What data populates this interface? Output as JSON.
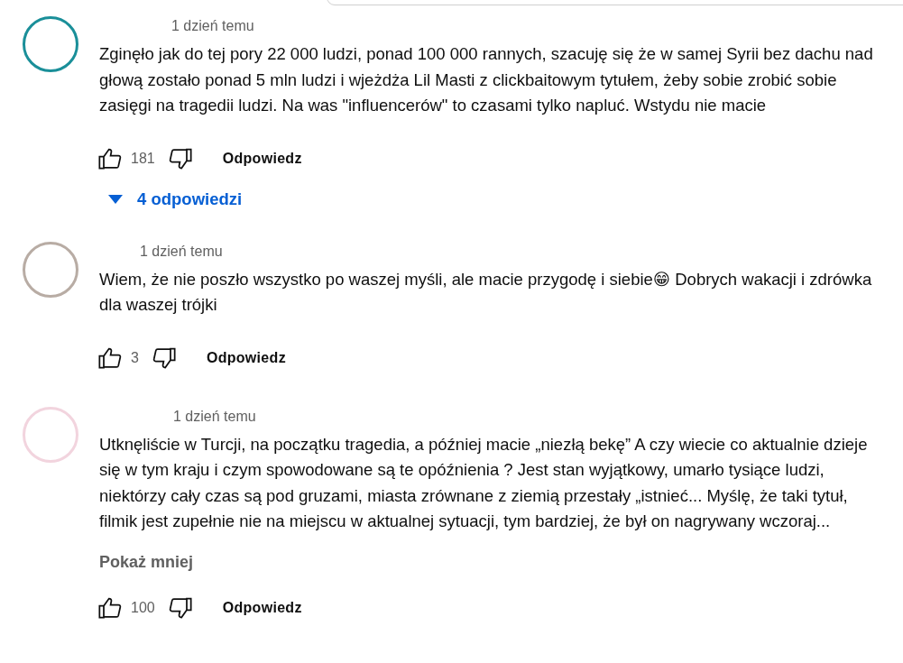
{
  "comments": [
    {
      "avatar": {
        "color": "#1a8f99"
      },
      "time": "1 dzień temu",
      "text": "Zginęło jak do tej pory 22 000 ludzi, ponad 100 000 rannych, szacuję się że w samej Syrii bez dachu nad głową zostało ponad 5 mln ludzi i wjeżdża Lil Masti z clickbaitowym tytułem, żeby sobie zrobić sobie zasięgi na tragedii ludzi. Na was \"influencerów\" to czasami tylko napluć. Wstydu nie macie",
      "likes": "181",
      "reply": "Odpowiedz",
      "replies": {
        "label": "4 odpowiedzi",
        "expanded": false
      }
    },
    {
      "avatar": {
        "color": "#b8aca4"
      },
      "time": "1 dzień temu",
      "text": "Wiem, że nie poszło wszystko po waszej myśli, ale macie przygodę i siebie😁 Dobrych wakacji i zdrówka dla waszej trójki",
      "likes": "3",
      "reply": "Odpowiedz"
    },
    {
      "avatar": {
        "color": "#f2d4de"
      },
      "time": "1 dzień temu",
      "text": "Utknęliście w Turcji, na początku tragedia, a później macie „niezłą bekę” A czy wiecie co aktualnie dzieje się w tym kraju i czym spowodowane są te opóźnienia ? Jest stan wyjątkowy, umarło tysiące ludzi, niektórzy cały czas są pod gruzami, miasta zrównane z ziemią przestały „istnieć... Myślę, że taki tytuł, filmik  jest zupełnie nie na miejscu w aktualnej sytuacji, tym bardziej, że był on nagrywany wczoraj...",
      "more": "Pokaż mniej",
      "likes": "100",
      "reply": "Odpowiedz"
    }
  ]
}
